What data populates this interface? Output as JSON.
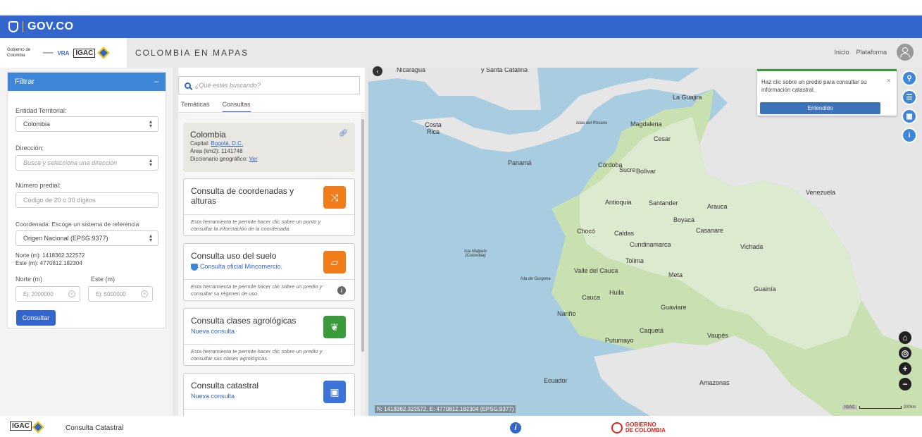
{
  "gov_bar": {
    "text": "GOV.CO"
  },
  "header": {
    "gob_logo": "Gobierno de Colombia",
    "partner_logo": "VRA",
    "igac_logo": "IGAC",
    "app_title": "COLOMBIA EN MAPAS",
    "nav": [
      "Inicio",
      "Plataforma"
    ],
    "user_icon": "user-icon"
  },
  "filter": {
    "title": "Filtrar",
    "collapse": "–",
    "entidad_label": "Entidad Territorial:",
    "entidad_value": "Colombia",
    "direccion_label": "Dirección:",
    "direccion_placeholder": "Busca y selecciona una dirección",
    "predial_label": "Número predial:",
    "predial_placeholder": "Código de 20 o 30 dígitos",
    "coord_label": "Coordenada: Escoge un sistema de referencia",
    "coord_value": "Origen Nacional (EPSG:9377)",
    "norte_readout": "Norte (m): 1418362.322572",
    "este_readout": "Este (m): 4770812.182304",
    "norte_label": "Norte (m)",
    "este_label": "Este (m)",
    "norte_placeholder": "Ej: 2000000",
    "este_placeholder": "Ej: 5000000",
    "submit": "Consultar"
  },
  "search": {
    "placeholder": "¿Qué estás buscando?"
  },
  "tabs": [
    "Temáticas",
    "Consultas"
  ],
  "info": {
    "title": "Colombia",
    "capital_label": "Capital:",
    "capital_value": "Bogotá, D.C.",
    "area": "Área (km2): 1141748",
    "dict_label": "Diccionario geográfico:",
    "dict_link": "Ver"
  },
  "cards": [
    {
      "title": "Consulta de coordenadas y alturas",
      "subtitle": "",
      "desc": "Esta herramienta te permite hacer clic sobre un punto y consultar la información de la coordenada.",
      "icon": "arrows-icon",
      "color": "#f07c1a"
    },
    {
      "title": "Consulta uso del suelo",
      "subtitle": "Consulta oficial Mincomercio.",
      "desc": "Esta herramienta te permite hacer clic sobre un predio y consultar su régimen de uso.",
      "icon": "land-icon",
      "color": "#f07c1a"
    },
    {
      "title": "Consulta clases agrológicas",
      "subtitle": "Nueva consulta",
      "desc": "Esta herramienta te permite hacer clic sobre un predio y consultar sus clases agrológicas.",
      "icon": "plant-icon",
      "color": "#3a9b3a"
    },
    {
      "title": "Consulta catastral",
      "subtitle": "Nueva consulta",
      "desc": "",
      "icon": "parcel-icon",
      "color": "#3d73d8"
    }
  ],
  "map": {
    "labels": [
      "Nicaragua",
      "y Santa Catalina",
      "Costa Rica",
      "Panamá",
      "La Guajira",
      "Magdalena",
      "Cesar",
      "Sucre",
      "Córdoba",
      "Bolívar",
      "Venezuela",
      "Antioquia",
      "Santander",
      "Arauca",
      "Boyacá",
      "Chocó",
      "Caldas",
      "Casanare",
      "Cundinamarca",
      "Vichada",
      "Tolima",
      "Valle del Cauca",
      "Meta",
      "Huila",
      "Guainía",
      "Cauca",
      "Guaviare",
      "Nariño",
      "Caquetá",
      "Vaupés",
      "Putumayo",
      "Ecuador",
      "Amazonas"
    ],
    "small_labels": [
      "Islas del Rosario",
      "Isla Malpelo (Colombia)",
      "Isla de Gorgona"
    ],
    "coords": "N: 1418362.322572, E: 4770812.182304 (EPSG:9377)",
    "scale_tag": "IGAC",
    "scale_label": "200km",
    "colors": {
      "sea": "#a8cde0",
      "land": "#e6e6e6",
      "forest": "#b9d99b",
      "colombia": "#f2f2f2"
    }
  },
  "toast": {
    "message": "Haz clic sobre un predio para consultar su información catastral.",
    "button": "Entendido",
    "close": "×"
  },
  "footer": {
    "igac": "IGAC",
    "title": "Consulta Catastral",
    "info_icon": "i",
    "gob_line1": "GOBIERNO",
    "gob_line2": "DE COLOMBIA"
  }
}
